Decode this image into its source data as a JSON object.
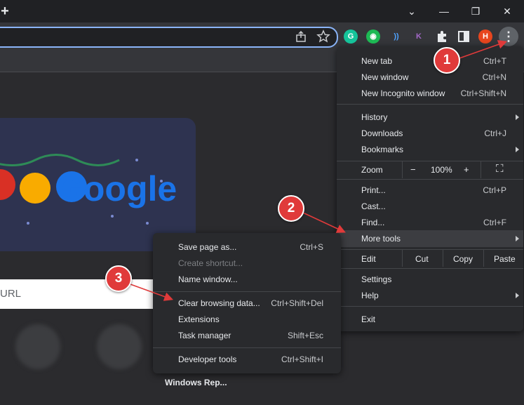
{
  "titlebar": {
    "new_tab_glyph": "+",
    "min_glyph": "—",
    "restore_glyph": "❐",
    "close_glyph": "✕",
    "dropdown_glyph": "⌄"
  },
  "toolbar": {
    "extensions": [
      {
        "name": "grammarly-icon",
        "glyph": "G",
        "color": "#15c39a"
      },
      {
        "name": "green-circle-extension-icon",
        "glyph": "◉",
        "color": "#1db954"
      },
      {
        "name": "wireless-extension-icon",
        "glyph": "))",
        "color": "#4fa3ff"
      },
      {
        "name": "k-extension-icon",
        "glyph": "K",
        "color": "#a368c8"
      }
    ],
    "profile_initial": "H",
    "profile_color": "#e8461e",
    "kebab_glyph": "⋮"
  },
  "page": {
    "doodle_text": "Google",
    "search_placeholder": "URL",
    "shortcut_label": "Windows Rep..."
  },
  "main_menu": {
    "new_tab": {
      "label": "New tab",
      "shortcut": "Ctrl+T"
    },
    "new_window": {
      "label": "New window",
      "shortcut": "Ctrl+N"
    },
    "new_incognito": {
      "label": "New Incognito window",
      "shortcut": "Ctrl+Shift+N"
    },
    "history": {
      "label": "History"
    },
    "downloads": {
      "label": "Downloads",
      "shortcut": "Ctrl+J"
    },
    "bookmarks": {
      "label": "Bookmarks"
    },
    "zoom": {
      "label": "Zoom",
      "minus": "−",
      "value": "100%",
      "plus": "+",
      "fullscreen": "⛶"
    },
    "print": {
      "label": "Print...",
      "shortcut": "Ctrl+P"
    },
    "cast": {
      "label": "Cast..."
    },
    "find": {
      "label": "Find...",
      "shortcut": "Ctrl+F"
    },
    "more_tools": {
      "label": "More tools"
    },
    "edit": {
      "label": "Edit",
      "cut": "Cut",
      "copy": "Copy",
      "paste": "Paste"
    },
    "settings": {
      "label": "Settings"
    },
    "help": {
      "label": "Help"
    },
    "exit": {
      "label": "Exit"
    }
  },
  "more_tools_menu": {
    "save_page": {
      "label": "Save page as...",
      "shortcut": "Ctrl+S"
    },
    "create_shortcut": {
      "label": "Create shortcut..."
    },
    "name_window": {
      "label": "Name window..."
    },
    "clear_browsing": {
      "label": "Clear browsing data...",
      "shortcut": "Ctrl+Shift+Del"
    },
    "extensions": {
      "label": "Extensions"
    },
    "task_manager": {
      "label": "Task manager",
      "shortcut": "Shift+Esc"
    },
    "developer_tools": {
      "label": "Developer tools",
      "shortcut": "Ctrl+Shift+I"
    }
  },
  "annotations": {
    "step1": "1",
    "step2": "2",
    "step3": "3",
    "arrow_color": "#e03a3a"
  }
}
